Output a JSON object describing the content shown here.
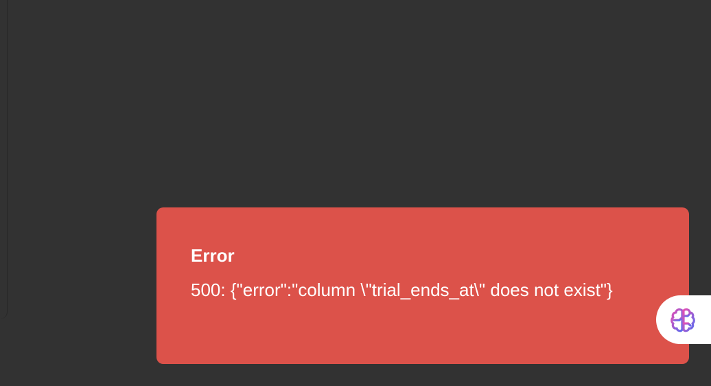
{
  "toast": {
    "title": "Error",
    "message": "500: {\"error\":\"column \\\"trial_ends_at\\\" does not exist\"}",
    "background_color": "#dc524a",
    "text_color": "#ffffff"
  },
  "assistant_button": {
    "icon": "brain-icon",
    "gradient_start": "#e64fb3",
    "gradient_end": "#5a6cf0"
  },
  "page": {
    "background_color": "#323232"
  }
}
